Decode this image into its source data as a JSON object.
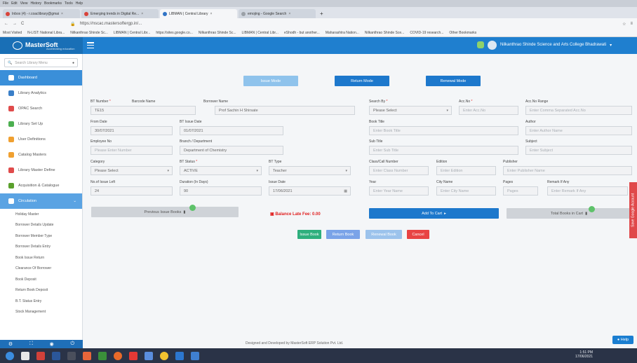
{
  "browser": {
    "menu": [
      "File",
      "Edit",
      "View",
      "History",
      "Bookmarks",
      "Tools",
      "Help"
    ],
    "tabs": [
      {
        "label": "Inbox (4) - r.coaclibrary@gmai",
        "color": "#d9433a",
        "active": false
      },
      {
        "label": "Emerging trends in Digital Re...",
        "color": "#d9433a",
        "active": false
      },
      {
        "label": "LIBMAN | Central Library",
        "color": "#2f73c5",
        "active": true
      },
      {
        "label": "emojing - Google Search",
        "color": "#9aa0a6",
        "active": false
      }
    ],
    "url": "https://nscac.mastersoftergp.in/...",
    "bookmarks": [
      "Most Visited",
      "N-LIST: National Libra...",
      "Nilkanthrao Shinde Sc...",
      "LIBMAN | Central Libr...",
      "https://sites.google.co...",
      "Nilkanthrao Shinde Sc...",
      "LIBMAN | Central Libr...",
      "eShodh - but another...",
      "Maharashtra Nation...",
      "Nilkanthrao Shinde Sce...",
      "COVID-19 research...",
      "Other Bookmarks"
    ]
  },
  "header": {
    "brand": "MasterSoft",
    "tagline": "Accelerating education",
    "college": "Nilkanthrao Shinde Science and Arts College Bhadrawati"
  },
  "sidebar": {
    "search_placeholder": "Search Library Menu",
    "items": [
      {
        "label": "Dashboard",
        "icon": "home-icon",
        "color": "#ffffff",
        "state": "active"
      },
      {
        "label": "Library Analytics",
        "icon": "chart-icon",
        "color": "#3a7fc8",
        "state": ""
      },
      {
        "label": "OPAC Search",
        "icon": "search-icon",
        "color": "#e04b4b",
        "state": ""
      },
      {
        "label": "Library Set Up",
        "icon": "settings-icon",
        "color": "#4caf50",
        "state": ""
      },
      {
        "label": "User Definitions",
        "icon": "users-icon",
        "color": "#f0a030",
        "state": ""
      },
      {
        "label": "Catalog Masters",
        "icon": "book-icon",
        "color": "#f0a030",
        "state": ""
      },
      {
        "label": "Library Master Define",
        "icon": "master-icon",
        "color": "#e04b4b",
        "state": ""
      },
      {
        "label": "Acquisition & Catalogue",
        "icon": "acquisition-icon",
        "color": "#5aa02c",
        "state": ""
      },
      {
        "label": "Circulation",
        "icon": "circulation-icon",
        "color": "#ffffff",
        "state": "open"
      }
    ],
    "sub_items": [
      "Holiday Master",
      "Borrower Details Update",
      "Borrower Member Type",
      "Borrower Details Entry",
      "Book Issue Return",
      "Clearance Of Borrower",
      "Book Deposit",
      "Return Book Deposit",
      "B.T. Status Entry",
      "Stock Management"
    ]
  },
  "modes": {
    "issue": "Issue Mode",
    "return": "Return Mode",
    "renewal": "Renewal Mode"
  },
  "borrower": {
    "bt_number_label": "BT Number",
    "bt_number": "TE15",
    "barcode_name_label": "Barcode Name",
    "borrower_name_label": "Borrower Name",
    "borrower_name": "Prof Sachin H Shirsate",
    "from_date_label": "From Date",
    "from_date": "30/07/2021",
    "bt_issue_date_label": "BT Issue Date",
    "bt_issue_date": "01/07/2021",
    "employee_no_label": "Employee No",
    "employee_no_placeholder": "Please Enter Number",
    "dept_label": "Branch / Department",
    "dept": "Department of Chemistry",
    "category_label": "Category",
    "category": "Please Select",
    "bt_status_label": "BT Status",
    "bt_status": "ACTIVE",
    "bt_type_label": "BT Type",
    "bt_type": "Teacher",
    "issue_left_label": "No.of Issue Left",
    "issue_left": "24",
    "duration_label": "Duration (In Days)",
    "duration": "90",
    "issue_date_label": "Issue Date",
    "issue_date": "17/06/2021",
    "previous_issue": "Previous Issue Books",
    "balance": "Balance Late Fee: 0.00"
  },
  "book": {
    "search_by_label": "Search By",
    "search_by": "Please Select",
    "acc_no_label": "Acc.No",
    "acc_no_placeholder": "Enter Acc.No",
    "acc_no_range_label": "Acc.No Range",
    "acc_no_range_placeholder": "Enter Comma Separated Acc.No",
    "book_title_label": "Book Title",
    "book_title_placeholder": "Enter Book Title",
    "author_label": "Author",
    "author_placeholder": "Enter Author Name",
    "sub_title_label": "Sub Title",
    "sub_title_placeholder": "Enter Sub Title",
    "subject_label": "Subject",
    "subject_placeholder": "Enter Subject",
    "call_number_label": "Class/Call Number",
    "call_number_placeholder": "Enter Class Number",
    "edition_label": "Edition",
    "edition_placeholder": "Enter Edition",
    "publisher_label": "Publisher",
    "publisher_placeholder": "Enter Publisher Name",
    "year_label": "Year",
    "year_placeholder": "Enter Year Name",
    "city_label": "City Name",
    "city_placeholder": "Enter City Name",
    "pages_label": "Pages",
    "pages_placeholder": "Pages",
    "remark_label": "Remark If Any",
    "remark_placeholder": "Enter Remark If Any",
    "add_to_cart": "Add To Cart",
    "total_in_cart": "Total Books in Cart"
  },
  "actions": {
    "issue": "Issue Book",
    "return": "Return Book",
    "renewal": "Renewal Book",
    "cancel": "Cancel"
  },
  "footer": "Designed and Developed by MasterSoft ERP Solution Pvt. Ltd.",
  "side_tab": "Save Google Account",
  "help": "Help",
  "tray": {
    "time": "1:51 PM",
    "date": "17/06/2021"
  },
  "colors": {
    "primary": "#1f7fcf",
    "mode_issue": "#8fc3ec",
    "mode_return": "#1d78cc",
    "mode_renewal": "#1d78cc",
    "issue_btn": "#2eaf7d",
    "return_btn": "#7aa3e8",
    "renewal_btn": "#9cc3ec",
    "cancel_btn": "#e84343",
    "late_fee": "#e02020"
  }
}
